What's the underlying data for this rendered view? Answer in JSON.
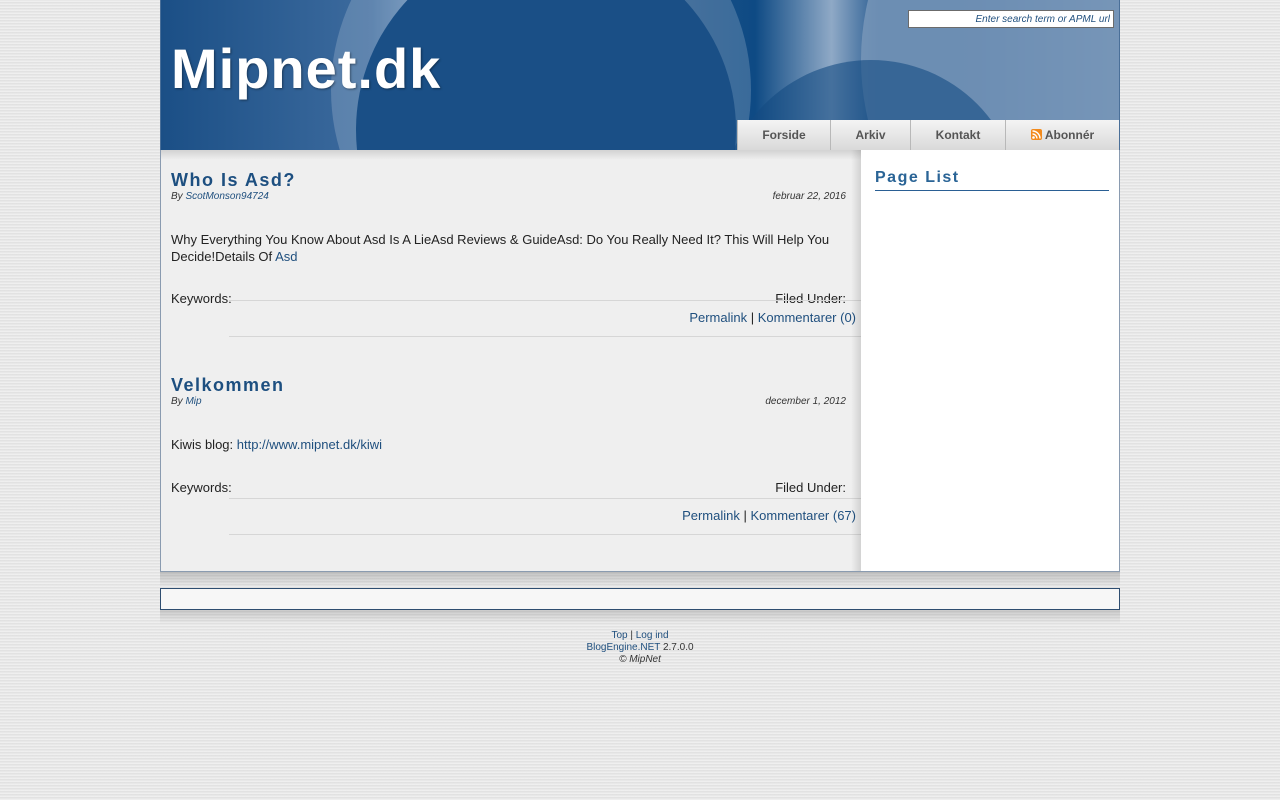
{
  "header": {
    "site_title": "Mipnet.dk",
    "search_placeholder": "Enter search term or APML url"
  },
  "nav": {
    "items": [
      {
        "label": "Forside"
      },
      {
        "label": "Arkiv"
      },
      {
        "label": "Kontakt"
      },
      {
        "label": "Abonnér",
        "icon": "rss-icon"
      }
    ]
  },
  "posts": [
    {
      "title": "Who Is Asd?",
      "by_label": "By",
      "author": "ScotMonson94724",
      "date": "februar 22, 2016",
      "body_text": "Why Everything You Know About Asd Is A LieAsd Reviews & GuideAsd: Do You Really Need It? This Will Help You Decide!Details Of",
      "body_link": "Asd",
      "keywords_label": "Keywords:",
      "filed_label": "Filed Under:",
      "permalink": "Permalink",
      "separator": "|",
      "comments": "Kommentarer (0)"
    },
    {
      "title": "Velkommen",
      "by_label": "By",
      "author": "Mip",
      "date": "december 1, 2012",
      "body_text": "Kiwis blog:",
      "body_link": "http://www.mipnet.dk/kiwi",
      "keywords_label": "Keywords:",
      "filed_label": "Filed Under:",
      "permalink": "Permalink",
      "separator": "|",
      "comments": "Kommentarer (67)"
    }
  ],
  "sidebar": {
    "title": "Page List"
  },
  "footer": {
    "top": "Top",
    "sep": "|",
    "login": "Log ind",
    "engine": "BlogEngine.NET",
    "version": "2.7.0.0",
    "copyright": "© MipNet"
  },
  "colors": {
    "link": "#1f4f7e",
    "title": "#1d4f80",
    "header_blue": "#1b4f86"
  }
}
